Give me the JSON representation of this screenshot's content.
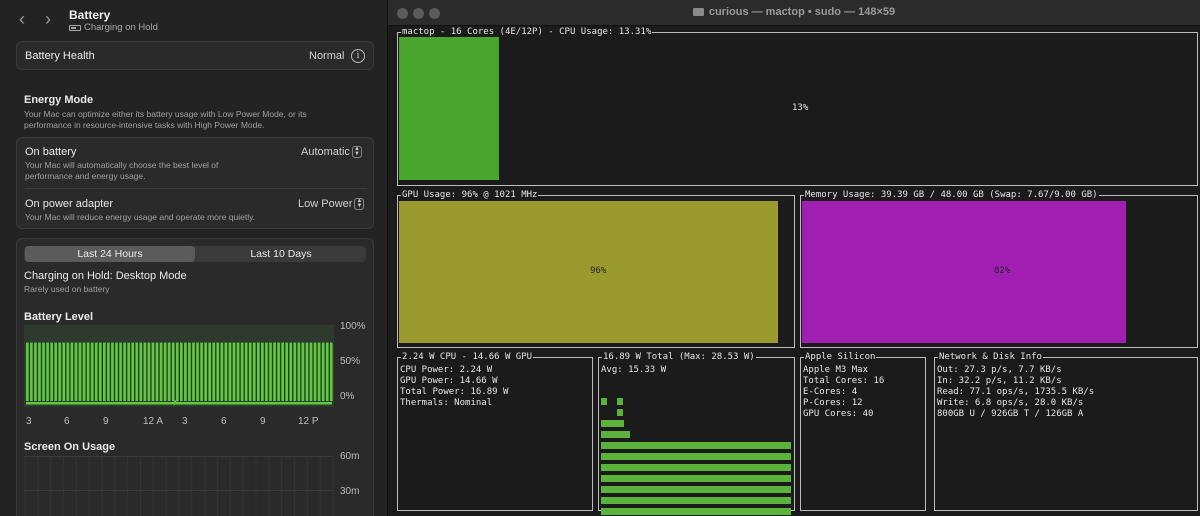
{
  "settings": {
    "title": "Battery",
    "subtitle": "Charging on Hold",
    "health": {
      "label": "Battery Health",
      "value": "Normal"
    },
    "energy_mode": {
      "title": "Energy Mode",
      "description_line1": "Your Mac can optimize either its battery usage with Low Power Mode, or its",
      "description_line2": "performance in resource-intensive tasks with High Power Mode.",
      "on_battery": {
        "label": "On battery",
        "desc_line1": "Your Mac will automatically choose the best level of",
        "desc_line2": "performance and energy usage.",
        "value": "Automatic"
      },
      "on_adapter": {
        "label": "On power adapter",
        "desc": "Your Mac will reduce energy usage and operate more quietly.",
        "value": "Low Power"
      }
    },
    "tabs": [
      {
        "label": "Last 24 Hours",
        "active": true
      },
      {
        "label": "Last 10 Days",
        "active": false
      }
    ],
    "status_title": "Charging on Hold: Desktop Mode",
    "status_desc": "Rarely used on battery",
    "battery_level": {
      "title": "Battery Level",
      "y_labels": [
        "100%",
        "50%",
        "0%"
      ],
      "x_labels": [
        "3",
        "6",
        "9",
        "12 A",
        "3",
        "6",
        "9",
        "12 P"
      ],
      "level_fraction": 0.8,
      "bar_color": "#5ecb3f"
    },
    "screen_on": {
      "title": "Screen On Usage",
      "y_labels": [
        "60m",
        "30m"
      ]
    }
  },
  "terminal": {
    "title": "curious — mactop • sudo — 148×59",
    "cpu": {
      "title": "mactop - 16 Cores (4E/12P) - CPU Usage: 13.31%",
      "label": "13%",
      "value": 0.1331,
      "color": "#4aa52e"
    },
    "gpu": {
      "title": "GPU Usage: 96% @ 1021 MHz",
      "label": "96%",
      "value": 0.96,
      "color": "#9b9a2f"
    },
    "memory": {
      "title": "Memory Usage: 39.39 GB / 48.00 GB (Swap: 7.67/9.00 GB)",
      "label": "82%",
      "value": 0.82,
      "color": "#a01fb2"
    },
    "power": {
      "title": "2.24 W CPU - 14.66 W GPU",
      "lines": [
        "CPU Power: 2.24 W",
        "GPU Power: 14.66 W",
        "Total Power: 16.89 W",
        "Thermals: Nominal"
      ]
    },
    "total": {
      "title": "16.89 W Total (Max: 28.53 W)",
      "avg": "Avg: 15.33 W",
      "history": [
        0.1,
        0.1,
        0.17,
        0.23,
        1,
        1,
        1,
        1,
        1,
        1,
        1,
        1,
        1,
        1,
        1,
        1,
        1,
        1,
        1,
        1,
        1,
        1,
        1,
        1,
        1,
        1,
        1,
        1,
        1,
        1,
        1,
        1,
        1,
        1,
        1,
        1,
        1,
        1,
        1,
        1
      ]
    },
    "silicon": {
      "title": "Apple Silicon",
      "lines": [
        "Apple M3 Max",
        "Total Cores: 16",
        "E-Cores: 4",
        "P-Cores: 12",
        "GPU Cores: 40"
      ]
    },
    "network": {
      "title": "Network & Disk Info",
      "lines": [
        "Out: 27.3 p/s, 7.7 KB/s",
        "In: 32.2 p/s, 11.2 KB/s",
        "Read: 77.1 ops/s, 1735.5 KB/s",
        "Write: 6.8 ops/s, 28.0 KB/s",
        "800GB U / 926GB T / 126GB A"
      ]
    }
  }
}
